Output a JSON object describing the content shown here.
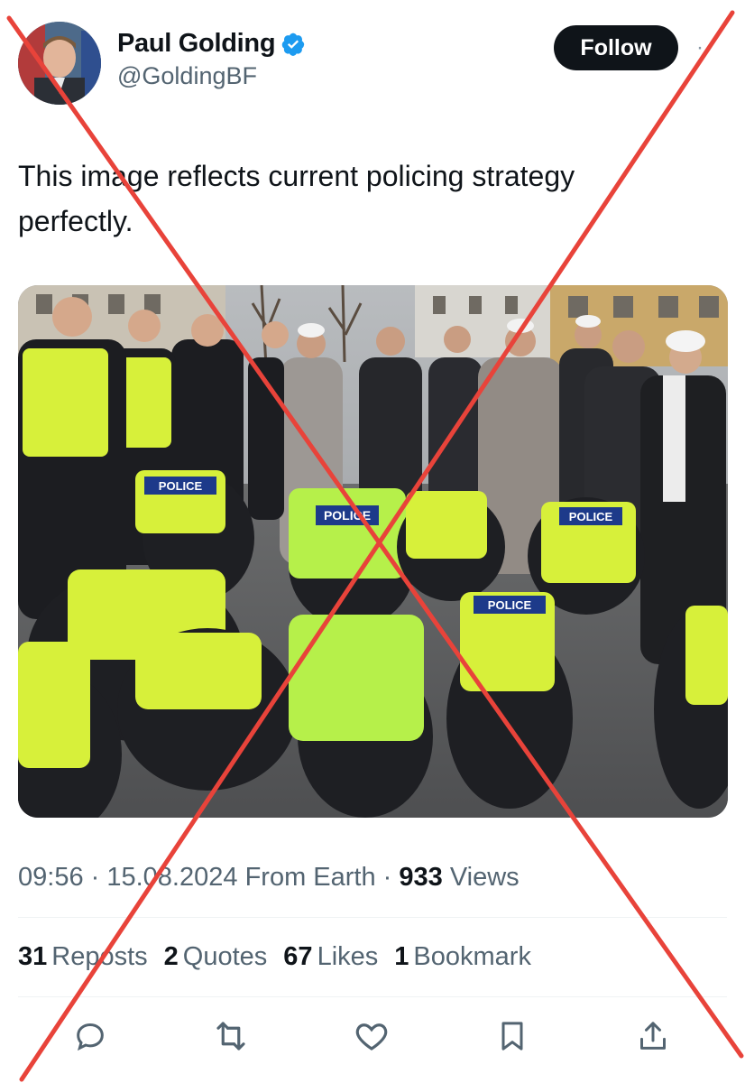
{
  "author": {
    "display_name": "Paul Golding",
    "handle": "@GoldingBF",
    "verified": true
  },
  "follow_label": "Follow",
  "tweet": {
    "text_line1": "This image reflects current policing strategy",
    "text_line2": "perfectly."
  },
  "media": {
    "vest_label": "POLICE"
  },
  "meta": {
    "time": "09:56",
    "sep1": " · ",
    "date": "15.08.2024",
    "source": " From Earth",
    "sep2": " · ",
    "views_count": "933",
    "views_label": " Views"
  },
  "stats": {
    "reposts_count": "31",
    "reposts_label": "Reposts",
    "quotes_count": "2",
    "quotes_label": "Quotes",
    "likes_count": "67",
    "likes_label": "Likes",
    "bookmarks_count": "1",
    "bookmarks_label": "Bookmark"
  },
  "actions": [
    "reply-icon",
    "repost-icon",
    "like-icon",
    "bookmark-icon",
    "share-icon"
  ],
  "colors": {
    "verified_blue": "#1d9bf0",
    "cross_red": "#e8433a",
    "hi_vis": "#d7f03a"
  }
}
